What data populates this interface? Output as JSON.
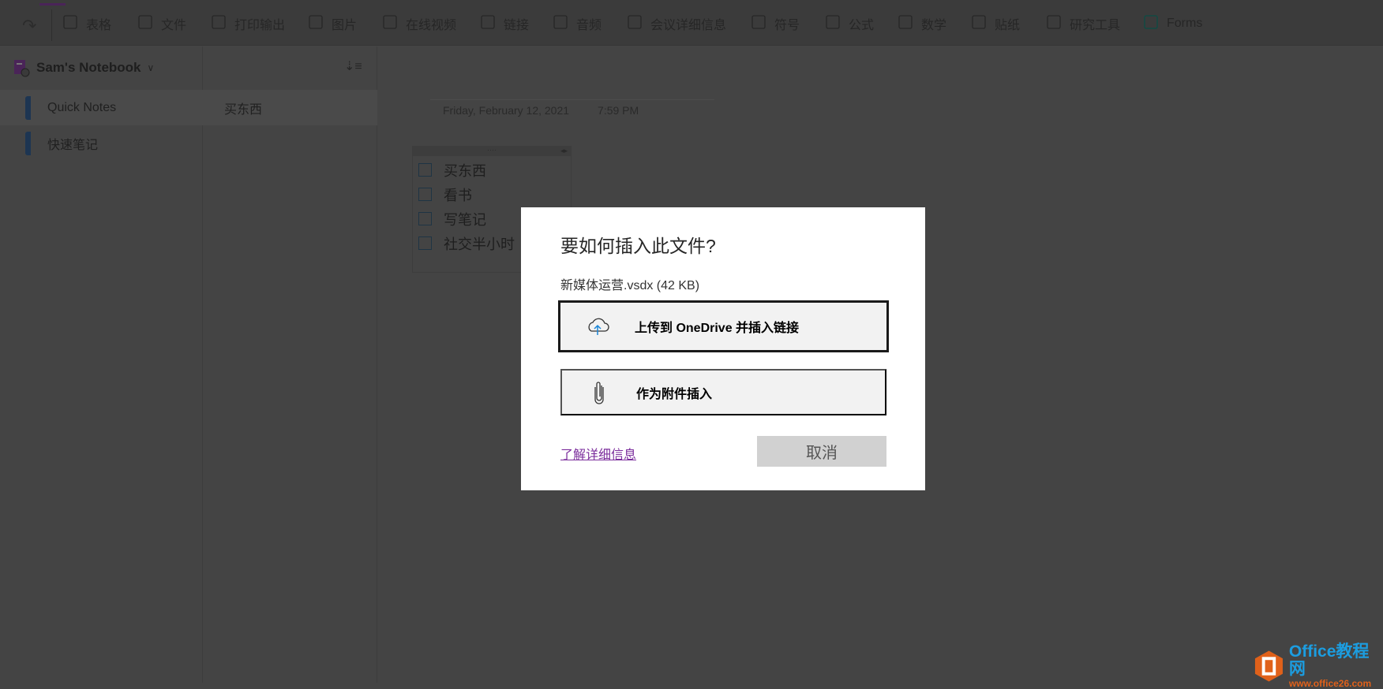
{
  "toolbar": {
    "items": [
      {
        "label": "表格",
        "icon": "table-icon"
      },
      {
        "label": "文件",
        "icon": "paperclip-icon"
      },
      {
        "label": "打印输出",
        "icon": "document-icon"
      },
      {
        "label": "图片",
        "icon": "picture-icon"
      },
      {
        "label": "在线视频",
        "icon": "online-video-icon"
      },
      {
        "label": "链接",
        "icon": "link-icon"
      },
      {
        "label": "音频",
        "icon": "audio-icon"
      },
      {
        "label": "会议详细信息",
        "icon": "calendar-icon"
      },
      {
        "label": "符号",
        "icon": "omega-icon"
      },
      {
        "label": "公式",
        "icon": "pi-icon"
      },
      {
        "label": "数学",
        "icon": "math-icon"
      },
      {
        "label": "贴纸",
        "icon": "smiley-icon"
      },
      {
        "label": "研究工具",
        "icon": "research-icon"
      },
      {
        "label": "Forms",
        "icon": "forms-icon"
      }
    ]
  },
  "notebook": {
    "title": "Sam's Notebook",
    "sections": [
      "Quick Notes",
      "快速笔记"
    ],
    "pages": [
      "买东西"
    ]
  },
  "page": {
    "date": "Friday, February 12, 2021",
    "time": "7:59 PM",
    "checklist": [
      "买东西",
      "看书",
      "写笔记",
      "社交半小时"
    ]
  },
  "dialog": {
    "title": "要如何插入此文件?",
    "file": "新媒体运营.vsdx (42 KB)",
    "option_upload": "上传到 OneDrive 并插入链接",
    "option_attach": "作为附件插入",
    "learn_more": "了解详细信息",
    "cancel": "取消"
  },
  "watermark": {
    "line1": "Office教程网",
    "line2": "www.office26.com"
  }
}
